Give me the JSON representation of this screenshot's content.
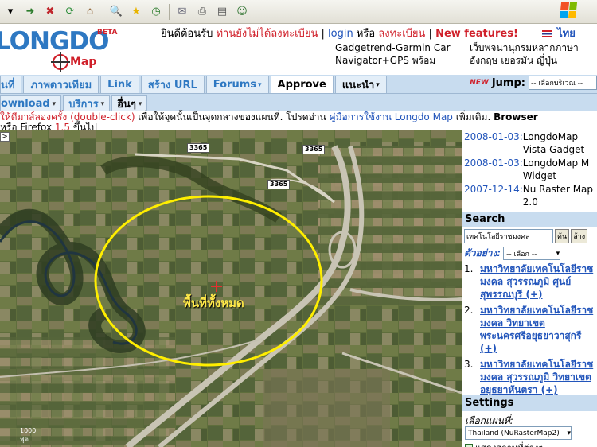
{
  "toolbar": {
    "icons": [
      "dropdown-arrow",
      "forward-icon",
      "stop-icon",
      "refresh-icon",
      "home-icon",
      "search-icon",
      "favorites-icon",
      "history-icon",
      "mail-icon",
      "print-icon",
      "edit-icon",
      "messenger-icon"
    ]
  },
  "header": {
    "logo_text": "LONGDO",
    "logo_beta": "BETA",
    "logo_map": "Map",
    "tagline_part1": "ยินดีต้อนรับ",
    "tagline_part2": "ท่านยังไม่ได้ลงทะเบียน",
    "tagline_sep": "|",
    "login": "login",
    "or": "หรือ",
    "register": "ลงทะเบียน",
    "sep2": "|",
    "new_features": "New features!",
    "lang": "ไทย",
    "promo_left_1": "Gadgetrend-Garmin Car",
    "promo_left_2": "Navigator+GPS พร้อม",
    "promo_right_1": "เว็บพจนานุกรมหลากภาษา",
    "promo_right_2": "อังกฤษ เยอรมัน ญี่ปุ่น"
  },
  "tabs": {
    "t1": "นที่",
    "t2": "ภาพดาวเทียม",
    "t3": "Link",
    "t4": "สร้าง URL",
    "t5": "Forums",
    "t6": "Approve",
    "t7": "แนะนำ",
    "new_badge": "NEW",
    "jump_label": "Jump:",
    "jump_value": "-- เลือกบริเวณ --"
  },
  "subtabs": {
    "s1": "ownload",
    "s2": "บริการ",
    "s3": "อื่นๆ"
  },
  "notice": {
    "line1_red": "ให้ดีมาส์ลองครั้ง (double-click)",
    "line1_black": " เพื่อให้จุดนั้นเป็นจุดกลางของแผนที่. โปรดอ่าน ",
    "line1_link": "คู่มือการใช้งาน Longdo Map",
    "line1_end": " เพิ่มเติม. ",
    "line1_bold": "Browser",
    "line2_a": "หรือ Firefox ",
    "line2_ver": "1.5",
    "line2_b": " ขึ้นไป"
  },
  "map": {
    "area_label": "พื้นที่ทั้งหมด",
    "road_1": "3365",
    "road_2": "3365",
    "road_3": "3365",
    "scale": "1000 ฟุต",
    "zoom_symbol": ">"
  },
  "news": [
    {
      "date": "2008-01-03:",
      "line1": "LongdoMap",
      "line2": "Vista Gadget"
    },
    {
      "date": "2008-01-03:",
      "line1": "LongdoMap M",
      "line2": "Widget"
    },
    {
      "date": "2007-12-14:",
      "line1": "Nu Raster Map",
      "line2": "2.0"
    }
  ],
  "search": {
    "title": "Search",
    "input_value": "เทคโนโลยีราชมงคล",
    "find_button": "ค้น",
    "clear_button": "ล้าง",
    "example_label": "ตัวอย่าง:",
    "example_value": "-- เลือก --"
  },
  "results": [
    {
      "num": "1.",
      "text": "มหาวิทยาลัยเทคโนโลยีราชมงคล สุวรรณภูมิ ศูนย์สุพรรณบุรี (+)"
    },
    {
      "num": "2.",
      "text": "มหาวิทยาลัยเทคโนโลยีราชมงคล วิทยาเขตพระนครศรีอยุธยาวาสุกรี (+)"
    },
    {
      "num": "3.",
      "text": "มหาวิทยาลัยเทคโนโลยีราชมงคล สุวรรณภูมิ วิทยาเขตอยุธยาหันตรา (+)"
    }
  ],
  "settings": {
    "title": "Settings",
    "map_label": "เลือกแผนที่:",
    "map_value": "Thailand (NuRasterMap2)",
    "checkbox_label": "แสดงสถานที่ต่างๆ"
  },
  "colors": {
    "brand_blue": "#2e78c2",
    "accent_red": "#d0202a",
    "circle_yellow": "#ffee00",
    "tab_bg": "#c8dcef"
  }
}
